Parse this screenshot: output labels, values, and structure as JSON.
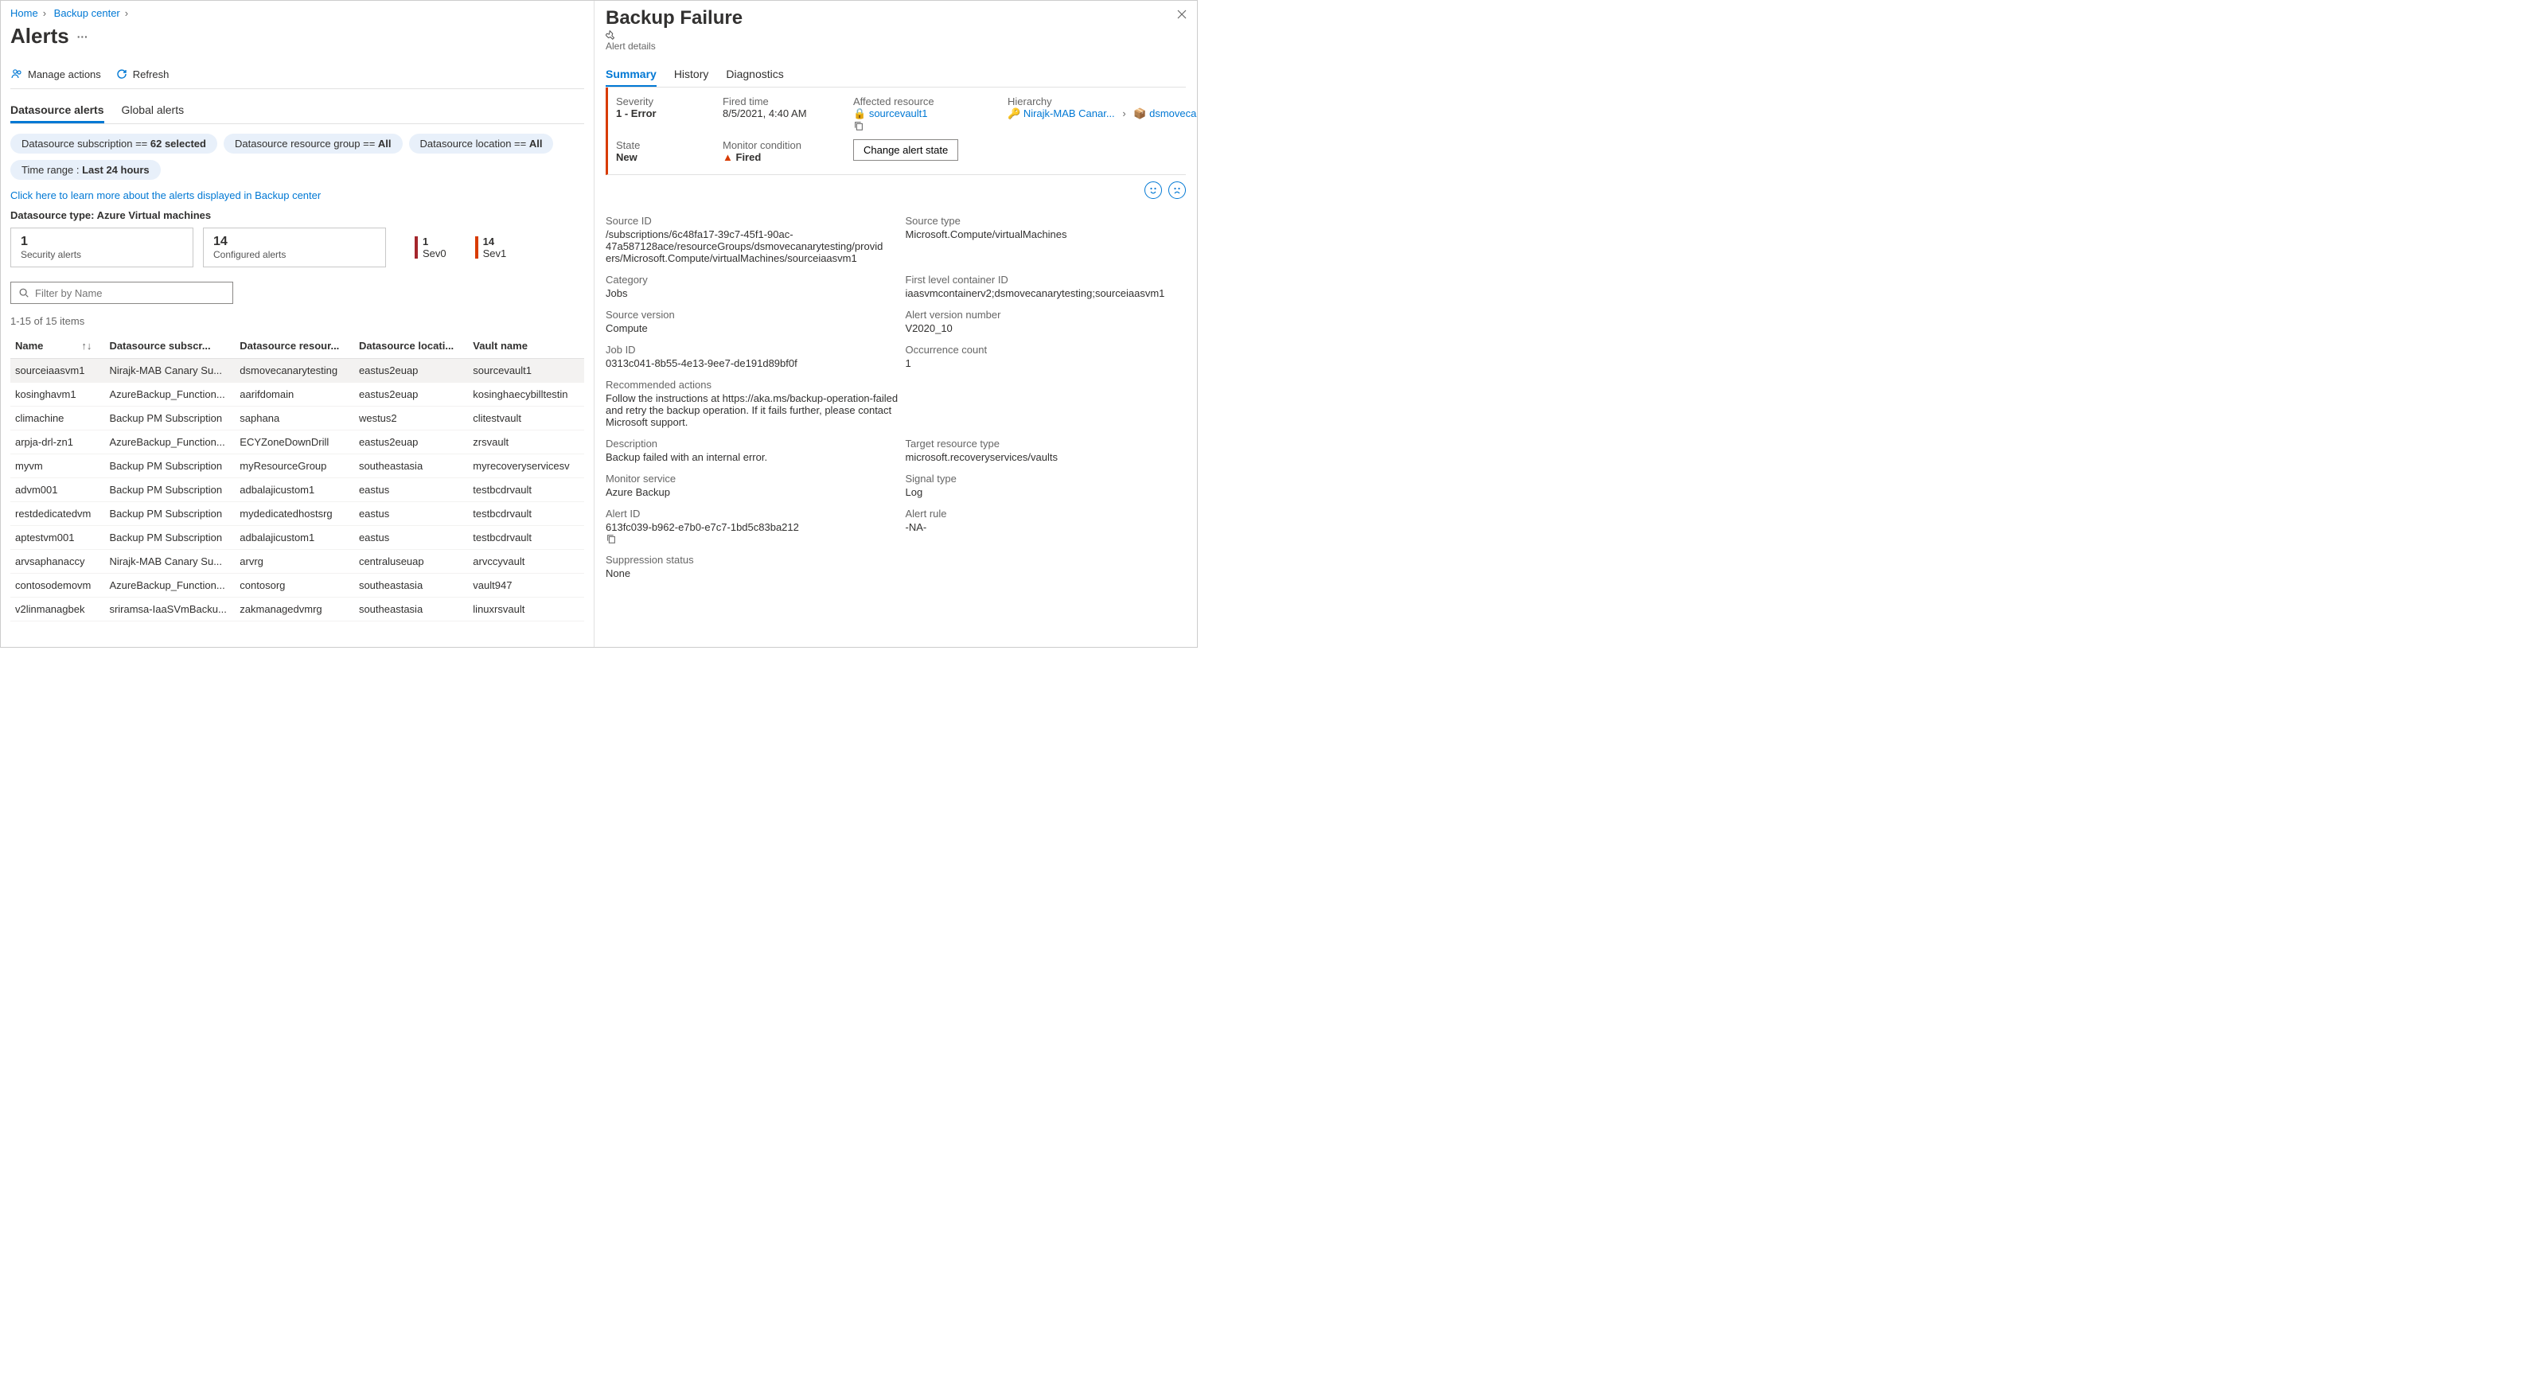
{
  "breadcrumb": {
    "home": "Home",
    "center": "Backup center"
  },
  "page_title": "Alerts",
  "toolbar": {
    "manage": "Manage actions",
    "refresh": "Refresh"
  },
  "tabs": {
    "ds": "Datasource alerts",
    "global": "Global alerts"
  },
  "pills": {
    "sub_prefix": "Datasource subscription == ",
    "sub_val": "62 selected",
    "rg_prefix": "Datasource resource group == ",
    "rg_val": "All",
    "loc_prefix": "Datasource location == ",
    "loc_val": "All",
    "time_prefix": "Time range : ",
    "time_val": "Last 24 hours"
  },
  "learn_link": "Click here to learn more about the alerts displayed in Backup center",
  "ds_type": "Datasource type: Azure Virtual machines",
  "cards": {
    "sec_num": "1",
    "sec_lbl": "Security alerts",
    "cfg_num": "14",
    "cfg_lbl": "Configured alerts",
    "sev0_num": "1",
    "sev0_lbl": "Sev0",
    "sev1_num": "14",
    "sev1_lbl": "Sev1"
  },
  "filter_placeholder": "Filter by Name",
  "count_text": "1-15 of 15 items",
  "columns": {
    "name": "Name",
    "sub": "Datasource subscr...",
    "rg": "Datasource resour...",
    "loc": "Datasource locati...",
    "vault": "Vault name"
  },
  "rows": [
    {
      "name": "sourceiaasvm1",
      "sub": "Nirajk-MAB Canary Su...",
      "rg": "dsmovecanarytesting",
      "loc": "eastus2euap",
      "vault": "sourcevault1"
    },
    {
      "name": "kosinghavm1",
      "sub": "AzureBackup_Function...",
      "rg": "aarifdomain",
      "loc": "eastus2euap",
      "vault": "kosinghaecybilltestin"
    },
    {
      "name": "climachine",
      "sub": "Backup PM Subscription",
      "rg": "saphana",
      "loc": "westus2",
      "vault": "clitestvault"
    },
    {
      "name": "arpja-drl-zn1",
      "sub": "AzureBackup_Function...",
      "rg": "ECYZoneDownDrill",
      "loc": "eastus2euap",
      "vault": "zrsvault"
    },
    {
      "name": "myvm",
      "sub": "Backup PM Subscription",
      "rg": "myResourceGroup",
      "loc": "southeastasia",
      "vault": "myrecoveryservicesv"
    },
    {
      "name": "advm001",
      "sub": "Backup PM Subscription",
      "rg": "adbalajicustom1",
      "loc": "eastus",
      "vault": "testbcdrvault"
    },
    {
      "name": "restdedicatedvm",
      "sub": "Backup PM Subscription",
      "rg": "mydedicatedhostsrg",
      "loc": "eastus",
      "vault": "testbcdrvault"
    },
    {
      "name": "aptestvm001",
      "sub": "Backup PM Subscription",
      "rg": "adbalajicustom1",
      "loc": "eastus",
      "vault": "testbcdrvault"
    },
    {
      "name": "arvsaphanaccy",
      "sub": "Nirajk-MAB Canary Su...",
      "rg": "arvrg",
      "loc": "centraluseuap",
      "vault": "arvccyvault"
    },
    {
      "name": "contosodemovm",
      "sub": "AzureBackup_Function...",
      "rg": "contosorg",
      "loc": "southeastasia",
      "vault": "vault947"
    },
    {
      "name": "v2linmanagbek",
      "sub": "sriramsa-IaaSVmBacku...",
      "rg": "zakmanagedvmrg",
      "loc": "southeastasia",
      "vault": "linuxrsvault"
    }
  ],
  "panel": {
    "title": "Backup Failure",
    "subtitle": "Alert details",
    "tabs": {
      "summary": "Summary",
      "history": "History",
      "diag": "Diagnostics"
    },
    "summary": {
      "sev_l": "Severity",
      "sev_v": "1 - Error",
      "time_l": "Fired time",
      "time_v": "8/5/2021, 4:40 AM",
      "res_l": "Affected resource",
      "res_v": "sourcevault1",
      "hier_l": "Hierarchy",
      "hier_v1": "Nirajk-MAB Canar...",
      "hier_v2": "dsmovecanaryte...",
      "state_l": "State",
      "state_v": "New",
      "mon_l": "Monitor condition",
      "mon_v": "Fired",
      "change_btn": "Change alert state"
    },
    "details": {
      "srcid_l": "Source ID",
      "srcid_v": "/subscriptions/6c48fa17-39c7-45f1-90ac-47a587128ace/resourceGroups/dsmovecanarytesting/providers/Microsoft.Compute/virtualMachines/sourceiaasvm1",
      "srct_l": "Source type",
      "srct_v": "Microsoft.Compute/virtualMachines",
      "cat_l": "Category",
      "cat_v": "Jobs",
      "flc_l": "First level container ID",
      "flc_v": "iaasvmcontainerv2;dsmovecanarytesting;sourceiaasvm1",
      "sv_l": "Source version",
      "sv_v": "Compute",
      "av_l": "Alert version number",
      "av_v": "V2020_10",
      "job_l": "Job ID",
      "job_v": "0313c041-8b55-4e13-9ee7-de191d89bf0f",
      "occ_l": "Occurrence count",
      "occ_v": "1",
      "rec_l": "Recommended actions",
      "rec_v": "Follow the instructions at https://aka.ms/backup-operation-failed and retry the backup operation. If it fails further, please contact Microsoft support.",
      "desc_l": "Description",
      "desc_v": "Backup failed with an internal error.",
      "trt_l": "Target resource type",
      "trt_v": "microsoft.recoveryservices/vaults",
      "ms_l": "Monitor service",
      "ms_v": "Azure Backup",
      "sig_l": "Signal type",
      "sig_v": "Log",
      "aid_l": "Alert ID",
      "aid_v": "613fc039-b962-e7b0-e7c7-1bd5c83ba212",
      "rule_l": "Alert rule",
      "rule_v": "-NA-",
      "sup_l": "Suppression status",
      "sup_v": "None"
    }
  }
}
